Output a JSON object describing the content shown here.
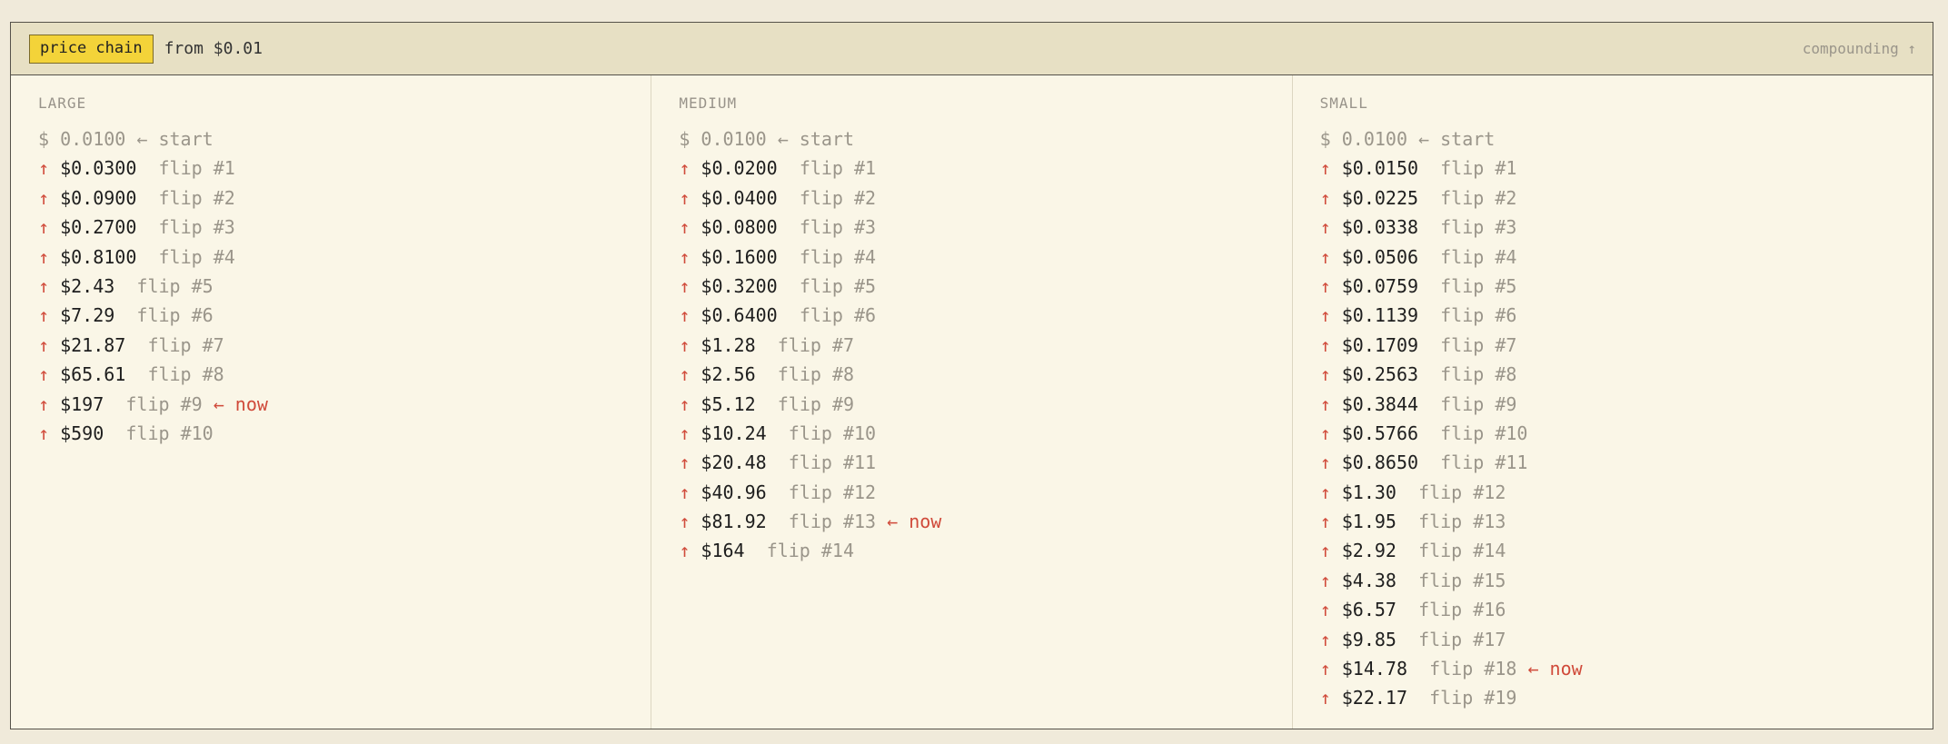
{
  "header": {
    "badge": "price chain",
    "subtitle": "from $0.01",
    "right_label": "compounding ↑"
  },
  "start_row": {
    "price": "$ 0.0100",
    "marker": "← start"
  },
  "up_arrow": "↑",
  "now_marker": "← now",
  "columns": [
    {
      "title": "LARGE",
      "rows": [
        {
          "price": "$0.0300",
          "flip": "flip #1"
        },
        {
          "price": "$0.0900",
          "flip": "flip #2"
        },
        {
          "price": "$0.2700",
          "flip": "flip #3"
        },
        {
          "price": "$0.8100",
          "flip": "flip #4"
        },
        {
          "price": "$2.43",
          "flip": "flip #5"
        },
        {
          "price": "$7.29",
          "flip": "flip #6"
        },
        {
          "price": "$21.87",
          "flip": "flip #7"
        },
        {
          "price": "$65.61",
          "flip": "flip #8"
        },
        {
          "price": "$197",
          "flip": "flip #9",
          "now": true
        },
        {
          "price": "$590",
          "flip": "flip #10"
        }
      ]
    },
    {
      "title": "MEDIUM",
      "rows": [
        {
          "price": "$0.0200",
          "flip": "flip #1"
        },
        {
          "price": "$0.0400",
          "flip": "flip #2"
        },
        {
          "price": "$0.0800",
          "flip": "flip #3"
        },
        {
          "price": "$0.1600",
          "flip": "flip #4"
        },
        {
          "price": "$0.3200",
          "flip": "flip #5"
        },
        {
          "price": "$0.6400",
          "flip": "flip #6"
        },
        {
          "price": "$1.28",
          "flip": "flip #7"
        },
        {
          "price": "$2.56",
          "flip": "flip #8"
        },
        {
          "price": "$5.12",
          "flip": "flip #9"
        },
        {
          "price": "$10.24",
          "flip": "flip #10"
        },
        {
          "price": "$20.48",
          "flip": "flip #11"
        },
        {
          "price": "$40.96",
          "flip": "flip #12"
        },
        {
          "price": "$81.92",
          "flip": "flip #13",
          "now": true
        },
        {
          "price": "$164",
          "flip": "flip #14"
        }
      ]
    },
    {
      "title": "SMALL",
      "rows": [
        {
          "price": "$0.0150",
          "flip": "flip #1"
        },
        {
          "price": "$0.0225",
          "flip": "flip #2"
        },
        {
          "price": "$0.0338",
          "flip": "flip #3"
        },
        {
          "price": "$0.0506",
          "flip": "flip #4"
        },
        {
          "price": "$0.0759",
          "flip": "flip #5"
        },
        {
          "price": "$0.1139",
          "flip": "flip #6"
        },
        {
          "price": "$0.1709",
          "flip": "flip #7"
        },
        {
          "price": "$0.2563",
          "flip": "flip #8"
        },
        {
          "price": "$0.3844",
          "flip": "flip #9"
        },
        {
          "price": "$0.5766",
          "flip": "flip #10"
        },
        {
          "price": "$0.8650",
          "flip": "flip #11"
        },
        {
          "price": "$1.30",
          "flip": "flip #12"
        },
        {
          "price": "$1.95",
          "flip": "flip #13"
        },
        {
          "price": "$2.92",
          "flip": "flip #14"
        },
        {
          "price": "$4.38",
          "flip": "flip #15"
        },
        {
          "price": "$6.57",
          "flip": "flip #16"
        },
        {
          "price": "$9.85",
          "flip": "flip #17"
        },
        {
          "price": "$14.78",
          "flip": "flip #18",
          "now": true
        },
        {
          "price": "$22.17",
          "flip": "flip #19"
        }
      ]
    }
  ]
}
